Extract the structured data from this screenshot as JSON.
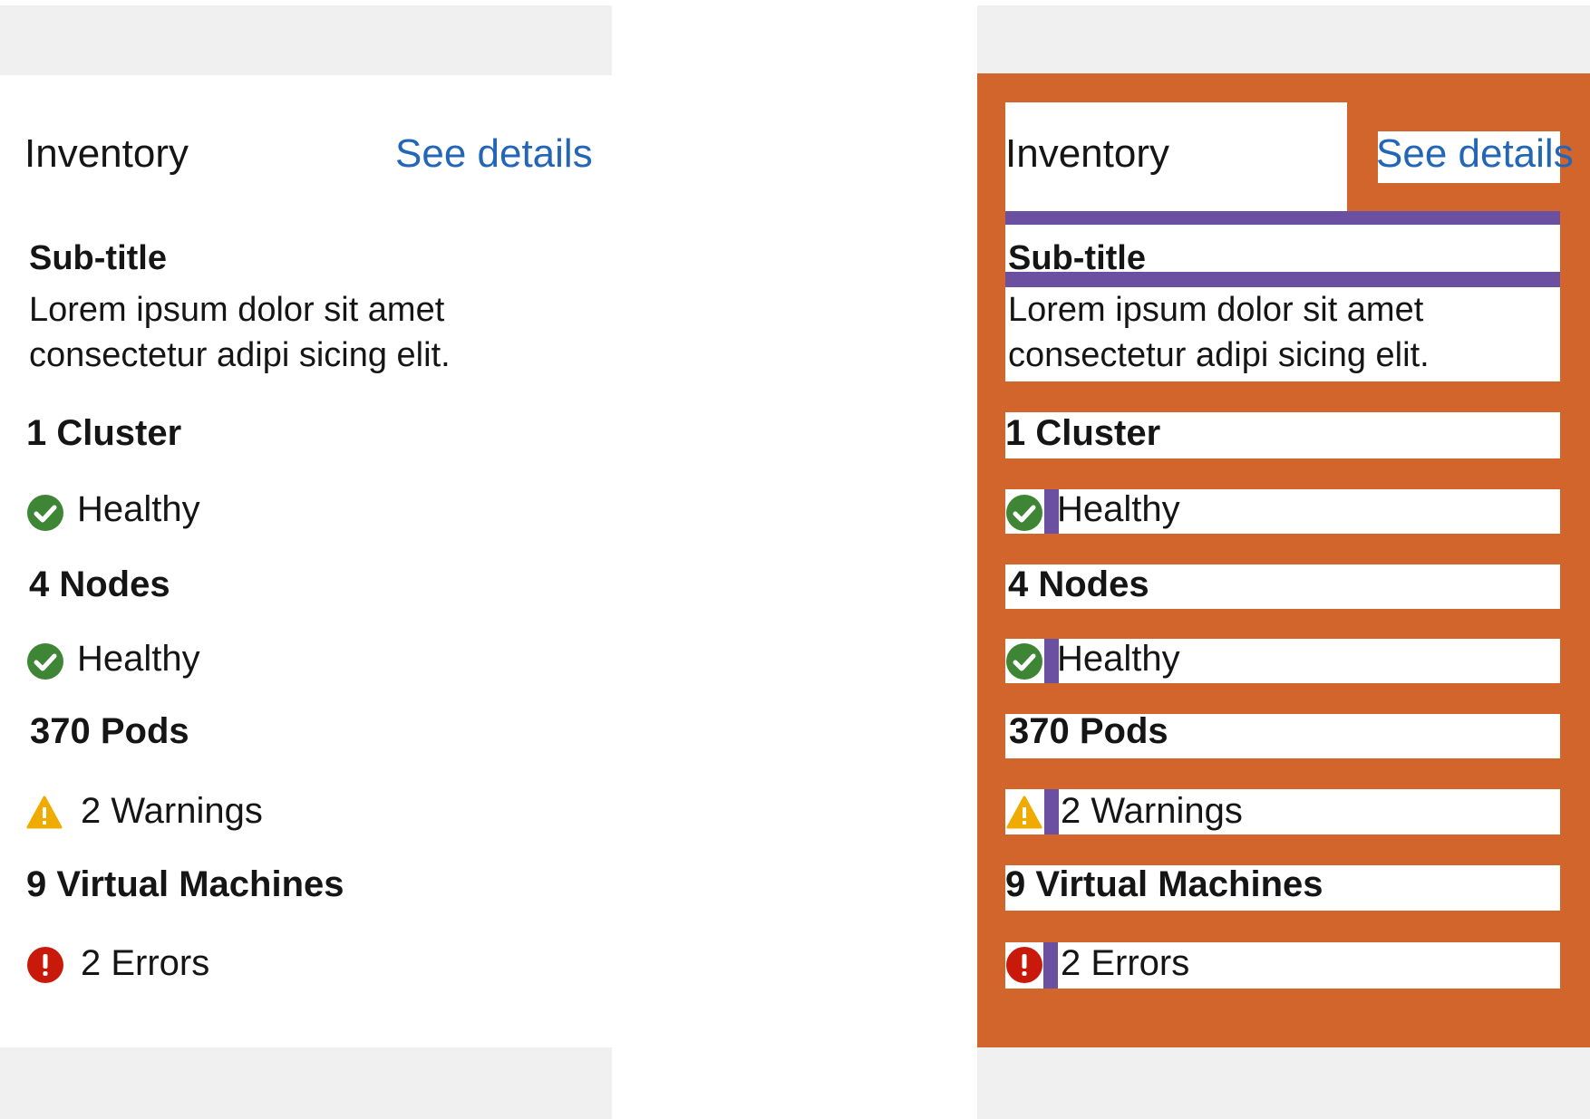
{
  "card": {
    "title": "Inventory",
    "details_link": "See details",
    "subtitle": "Sub-title",
    "description_line1": "Lorem ipsum dolor sit amet",
    "description_line2": "consectetur adipi sicing elit.",
    "items": [
      {
        "count": "1 Cluster",
        "status": "Healthy",
        "status_icon": "check-circle-icon",
        "status_is_link": false
      },
      {
        "count": "4 Nodes",
        "status": "Healthy",
        "status_icon": "check-circle-icon",
        "status_is_link": false
      },
      {
        "count": "370 Pods",
        "status": "2 Warnings",
        "status_icon": "warning-triangle-icon",
        "status_is_link": true
      },
      {
        "count": "9 Virtual Machines",
        "status": "2 Errors",
        "status_icon": "error-circle-icon",
        "status_is_link": true
      }
    ]
  },
  "colors": {
    "link": "#2366b8",
    "healthy": "#3e8635",
    "warning": "#f0ab00",
    "error": "#c9190b",
    "spacing_overlay": "#d2652b",
    "gap_overlay": "#6b4fa0",
    "background_band": "#f0f0f0"
  }
}
